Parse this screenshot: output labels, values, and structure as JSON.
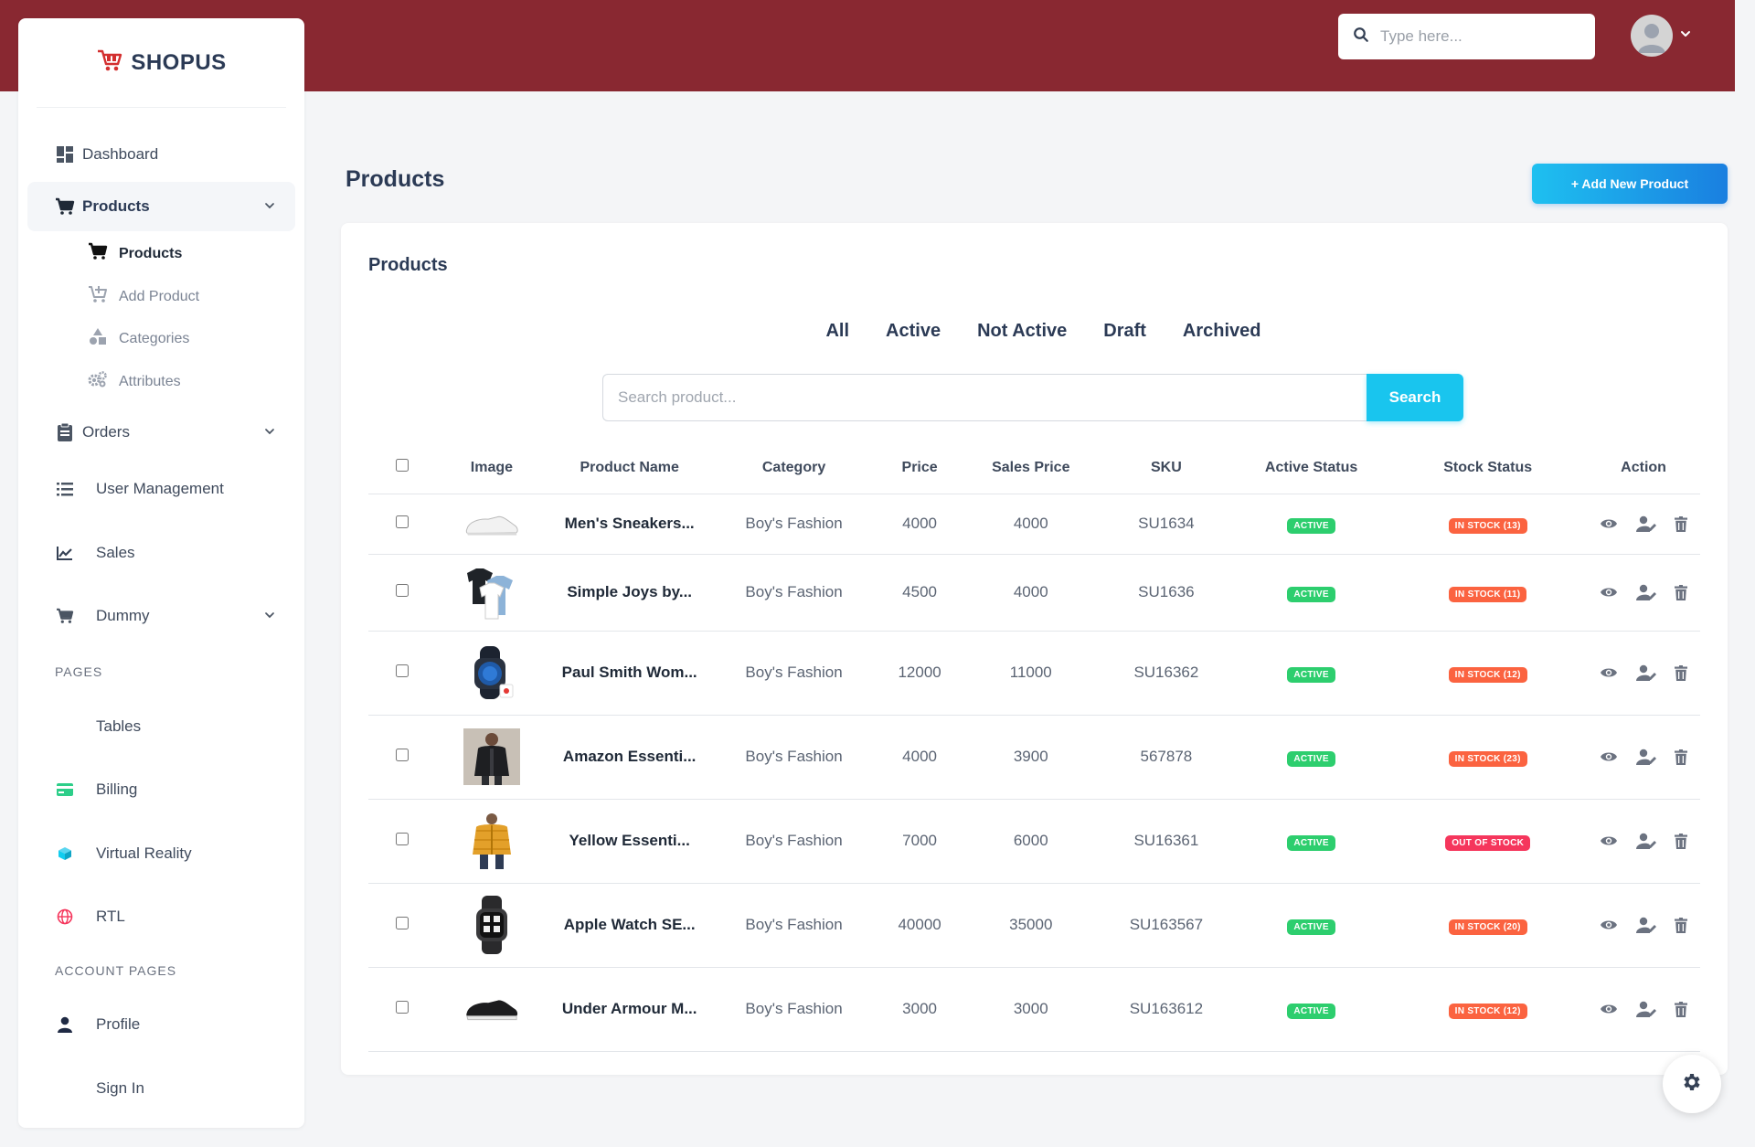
{
  "brand": {
    "name": "SHOPUS",
    "accent": "#892831"
  },
  "topbar": {
    "search_placeholder": "Type here..."
  },
  "sidebar": {
    "dashboard": "Dashboard",
    "products": "Products",
    "products_sub": [
      "Products",
      "Add Product",
      "Categories",
      "Attributes"
    ],
    "orders": "Orders",
    "user_management": "User Management",
    "sales": "Sales",
    "dummy": "Dummy",
    "pages_label": "PAGES",
    "tables": "Tables",
    "billing": "Billing",
    "virtual_reality": "Virtual Reality",
    "rtl": "RTL",
    "account_label": "ACCOUNT PAGES",
    "profile": "Profile",
    "sign_in": "Sign In"
  },
  "page": {
    "title": "Products",
    "add_button": "+ Add  New Product",
    "card_title": "Products",
    "tabs": [
      "All",
      "Active",
      "Not Active",
      "Draft",
      "Archived"
    ],
    "search_placeholder": "Search product...",
    "search_button": "Search"
  },
  "table": {
    "headers": [
      "Image",
      "Product Name",
      "Category",
      "Price",
      "Sales Price",
      "SKU",
      "Active Status",
      "Stock Status",
      "Action"
    ],
    "rows": [
      {
        "name": "Men's Sneakers...",
        "category": "Boy's Fashion",
        "price": "4000",
        "sales_price": "4000",
        "sku": "SU1634",
        "active": "ACTIVE",
        "stock": "IN STOCK (13)",
        "stock_type": "in",
        "image": "white-sneaker"
      },
      {
        "name": "Simple Joys by...",
        "category": "Boy's Fashion",
        "price": "4500",
        "sales_price": "4000",
        "sku": "SU1636",
        "active": "ACTIVE",
        "stock": "IN STOCK (11)",
        "stock_type": "in",
        "image": "tshirts"
      },
      {
        "name": "Paul Smith Wom...",
        "category": "Boy's Fashion",
        "price": "12000",
        "sales_price": "11000",
        "sku": "SU16362",
        "active": "ACTIVE",
        "stock": "IN STOCK (12)",
        "stock_type": "in",
        "image": "smartwatch-blue"
      },
      {
        "name": "Amazon Essenti...",
        "category": "Boy's Fashion",
        "price": "4000",
        "sales_price": "3900",
        "sku": "567878",
        "active": "ACTIVE",
        "stock": "IN STOCK (23)",
        "stock_type": "in",
        "image": "black-jacket"
      },
      {
        "name": "Yellow Essenti...",
        "category": "Boy's Fashion",
        "price": "7000",
        "sales_price": "6000",
        "sku": "SU16361",
        "active": "ACTIVE",
        "stock": "OUT OF STOCK",
        "stock_type": "out",
        "image": "yellow-jacket"
      },
      {
        "name": "Apple Watch SE...",
        "category": "Boy's Fashion",
        "price": "40000",
        "sales_price": "35000",
        "sku": "SU163567",
        "active": "ACTIVE",
        "stock": "IN STOCK (20)",
        "stock_type": "in",
        "image": "apple-watch"
      },
      {
        "name": "Under Armour M...",
        "category": "Boy's Fashion",
        "price": "3000",
        "sales_price": "3000",
        "sku": "SU163612",
        "active": "ACTIVE",
        "stock": "IN STOCK (12)",
        "stock_type": "in",
        "image": "black-sneaker"
      }
    ]
  },
  "colors": {
    "active_badge": "#2dce6e",
    "in_stock_badge": "#fb6340",
    "out_of_stock_badge": "#f5365c",
    "search_button": "#19c5ee"
  }
}
